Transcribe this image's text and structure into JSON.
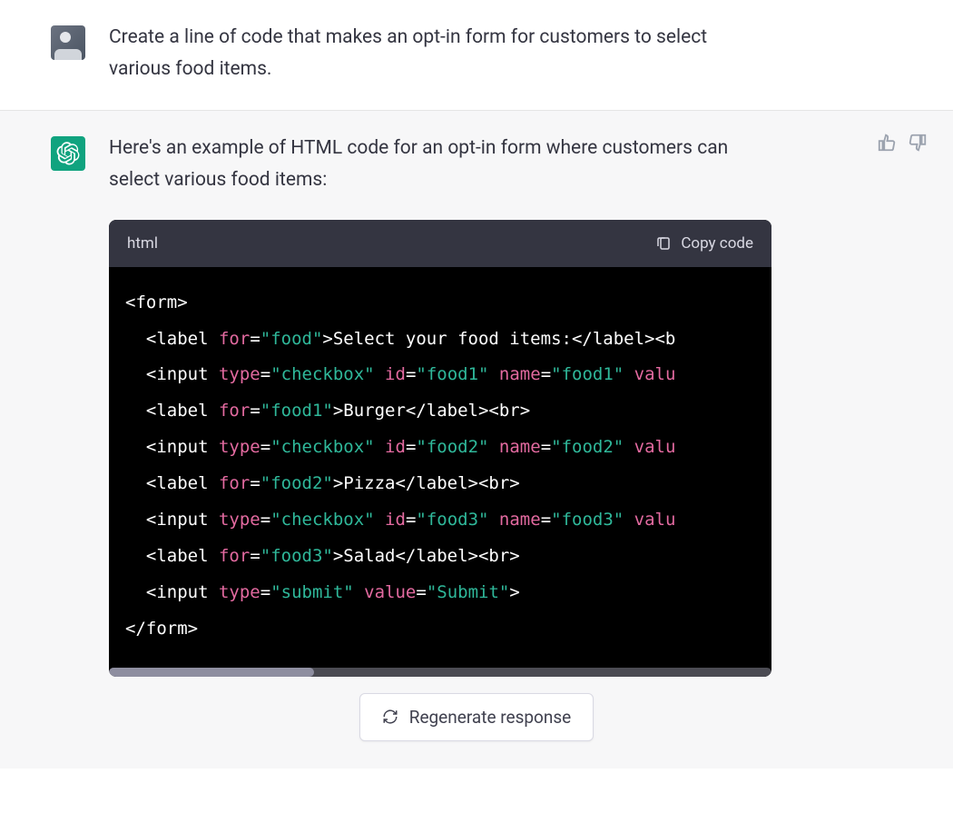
{
  "user_message": "Create a line of code that makes an opt-in form for customers to select various food items.",
  "assistant_intro": "Here's an example of HTML code for an opt-in form where customers can select various food items:",
  "code": {
    "language": "html",
    "copy_label": "Copy code"
  },
  "code_tokens": {
    "l1_tag": "<form>",
    "l2_tag_open": "<label",
    "l2_attr1": "for",
    "l2_str1": "\"food\"",
    "l2_text": ">Select your food items:</label><b",
    "l3_tag_open": "<input",
    "l3_attr1": "type",
    "l3_str1": "\"checkbox\"",
    "l3_attr2": "id",
    "l3_str2": "\"food1\"",
    "l3_attr3": "name",
    "l3_str3": "\"food1\"",
    "l3_attr4": "valu",
    "l4_tag_open": "<label",
    "l4_attr1": "for",
    "l4_str1": "\"food1\"",
    "l4_text": ">Burger</label><br>",
    "l5_tag_open": "<input",
    "l5_attr1": "type",
    "l5_str1": "\"checkbox\"",
    "l5_attr2": "id",
    "l5_str2": "\"food2\"",
    "l5_attr3": "name",
    "l5_str3": "\"food2\"",
    "l5_attr4": "valu",
    "l6_tag_open": "<label",
    "l6_attr1": "for",
    "l6_str1": "\"food2\"",
    "l6_text": ">Pizza</label><br>",
    "l7_tag_open": "<input",
    "l7_attr1": "type",
    "l7_str1": "\"checkbox\"",
    "l7_attr2": "id",
    "l7_str2": "\"food3\"",
    "l7_attr3": "name",
    "l7_str3": "\"food3\"",
    "l7_attr4": "valu",
    "l8_tag_open": "<label",
    "l8_attr1": "for",
    "l8_str1": "\"food3\"",
    "l8_text": ">Salad</label><br>",
    "l9_tag_open": "<input",
    "l9_attr1": "type",
    "l9_str1": "\"submit\"",
    "l9_attr2": "value",
    "l9_str2": "\"Submit\"",
    "l9_close": ">",
    "l10_tag": "</form>"
  },
  "regenerate_label": "Regenerate response",
  "colors": {
    "assistant_accent": "#10a37f",
    "assistant_bg": "#f7f7f8",
    "code_bg": "#000000",
    "code_header_bg": "#343541"
  }
}
